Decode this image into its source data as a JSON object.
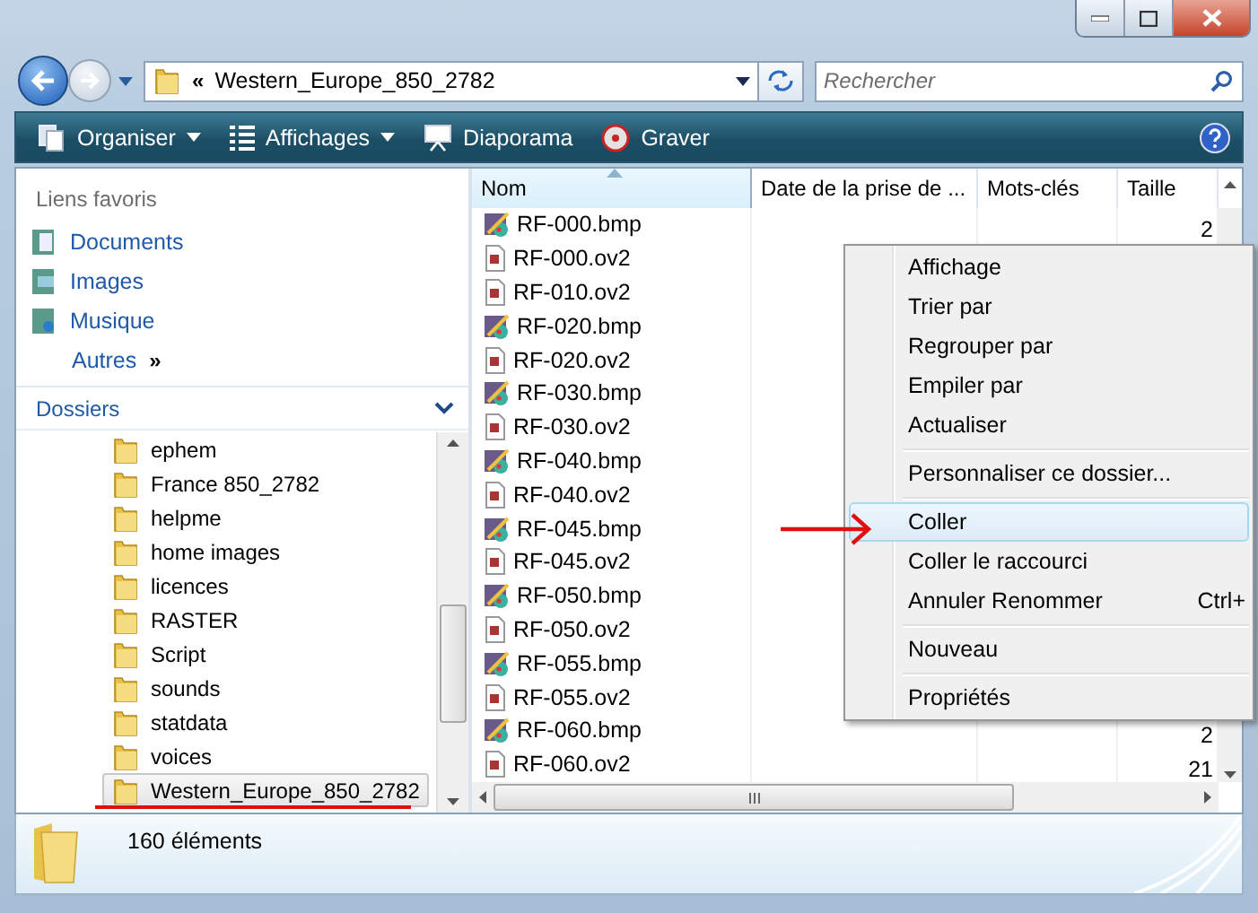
{
  "address_bar": {
    "overflow": "«",
    "path": "Western_Europe_850_2782"
  },
  "search": {
    "placeholder": "Rechercher"
  },
  "toolbar": [
    {
      "label": "Organiser",
      "kind": "organize",
      "has_menu": true
    },
    {
      "label": "Affichages",
      "kind": "views",
      "has_menu": true
    },
    {
      "label": "Diaporama",
      "kind": "slideshow",
      "has_menu": false
    },
    {
      "label": "Graver",
      "kind": "burn",
      "has_menu": false
    }
  ],
  "sidebar": {
    "favorites_title": "Liens favoris",
    "favorites": [
      {
        "label": "Documents",
        "kind": "documents"
      },
      {
        "label": "Images",
        "kind": "pictures"
      },
      {
        "label": "Musique",
        "kind": "music"
      }
    ],
    "more": {
      "label": "Autres",
      "chevron": "»"
    },
    "folders_title": "Dossiers",
    "folders": [
      {
        "label": "ephem",
        "selected": false
      },
      {
        "label": "France 850_2782",
        "selected": false
      },
      {
        "label": "helpme",
        "selected": false
      },
      {
        "label": "home images",
        "selected": false
      },
      {
        "label": "licences",
        "selected": false
      },
      {
        "label": "RASTER",
        "selected": false
      },
      {
        "label": "Script",
        "selected": false
      },
      {
        "label": "sounds",
        "selected": false
      },
      {
        "label": "statdata",
        "selected": false
      },
      {
        "label": "voices",
        "selected": false
      },
      {
        "label": "Western_Europe_850_2782",
        "selected": true
      }
    ]
  },
  "file_list": {
    "columns": [
      {
        "label": "Nom",
        "sorted": true
      },
      {
        "label": "Date de la prise de ...",
        "sorted": false
      },
      {
        "label": "Mots-clés",
        "sorted": false
      },
      {
        "label": "Taille",
        "sorted": false
      }
    ],
    "rows": [
      {
        "name": "RF-000.bmp",
        "kind": "bmp",
        "size": "2"
      },
      {
        "name": "RF-000.ov2",
        "kind": "ov2"
      },
      {
        "name": "RF-010.ov2",
        "kind": "ov2"
      },
      {
        "name": "RF-020.bmp",
        "kind": "bmp"
      },
      {
        "name": "RF-020.ov2",
        "kind": "ov2"
      },
      {
        "name": "RF-030.bmp",
        "kind": "bmp"
      },
      {
        "name": "RF-030.ov2",
        "kind": "ov2"
      },
      {
        "name": "RF-040.bmp",
        "kind": "bmp"
      },
      {
        "name": "RF-040.ov2",
        "kind": "ov2"
      },
      {
        "name": "RF-045.bmp",
        "kind": "bmp"
      },
      {
        "name": "RF-045.ov2",
        "kind": "ov2"
      },
      {
        "name": "RF-050.bmp",
        "kind": "bmp"
      },
      {
        "name": "RF-050.ov2",
        "kind": "ov2"
      },
      {
        "name": "RF-055.bmp",
        "kind": "bmp"
      },
      {
        "name": "RF-055.ov2",
        "kind": "ov2"
      },
      {
        "name": "RF-060.bmp",
        "kind": "bmp",
        "size": "2"
      },
      {
        "name": "RF-060.ov2",
        "kind": "ov2",
        "size": "21"
      }
    ]
  },
  "context_menu": {
    "items": [
      {
        "kind": "item",
        "label": "Affichage",
        "selected": false
      },
      {
        "kind": "item",
        "label": "Trier par",
        "selected": false
      },
      {
        "kind": "item",
        "label": "Regrouper par",
        "selected": false
      },
      {
        "kind": "item",
        "label": "Empiler par",
        "selected": false
      },
      {
        "kind": "item",
        "label": "Actualiser",
        "selected": false
      },
      {
        "kind": "separator"
      },
      {
        "kind": "item",
        "label": "Personnaliser ce dossier...",
        "selected": false
      },
      {
        "kind": "separator"
      },
      {
        "kind": "item",
        "label": "Coller",
        "selected": true
      },
      {
        "kind": "item",
        "label": "Coller le raccourci",
        "selected": false
      },
      {
        "kind": "item",
        "label": "Annuler Renommer",
        "shortcut": "Ctrl+",
        "selected": false
      },
      {
        "kind": "separator"
      },
      {
        "kind": "item",
        "label": "Nouveau",
        "selected": false
      },
      {
        "kind": "separator"
      },
      {
        "kind": "item",
        "label": "Propriétés",
        "selected": false
      }
    ]
  },
  "status_bar": {
    "count": "160 éléments"
  }
}
